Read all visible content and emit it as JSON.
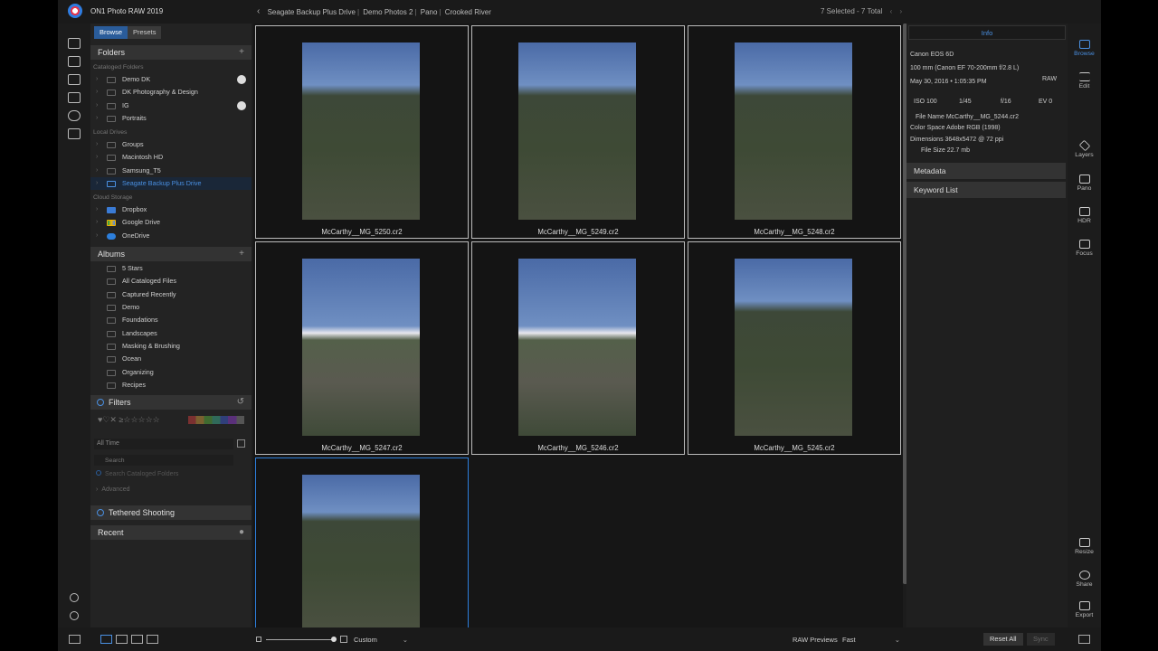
{
  "app": {
    "name": "ON1 Photo RAW 2019"
  },
  "breadcrumb": [
    "Seagate Backup Plus Drive",
    "Demo Photos 2",
    "Pano",
    "Crooked River"
  ],
  "selection": "7 Selected - 7 Total",
  "left_panel": {
    "tabs": [
      "Browse",
      "Presets"
    ],
    "folders": {
      "title": "Folders",
      "cataloged_label": "Cataloged Folders",
      "cataloged": [
        "Demo DK",
        "DK Photography & Design",
        "IG",
        "Portraits"
      ],
      "local_label": "Local Drives",
      "local": [
        "Groups",
        "Macintosh HD",
        "Samsung_T5",
        "Seagate Backup Plus Drive"
      ],
      "cloud_label": "Cloud Storage",
      "cloud": [
        "Dropbox",
        "Google Drive",
        "OneDrive"
      ]
    },
    "albums": {
      "title": "Albums",
      "items": [
        "5 Stars",
        "All Cataloged Files",
        "Captured Recently",
        "Demo",
        "Foundations",
        "Landscapes",
        "Masking & Brushing",
        "Ocean",
        "Organizing",
        "Recipes"
      ]
    },
    "filters": {
      "title": "Filters",
      "date": "All Time",
      "search_placeholder": "Search",
      "search_cataloged": "Search Cataloged Folders",
      "advanced": "Advanced"
    },
    "tethered": "Tethered Shooting",
    "recent": "Recent"
  },
  "photos": [
    {
      "name": "McCarthy__MG_5250.cr2",
      "snow": false
    },
    {
      "name": "McCarthy__MG_5249.cr2",
      "snow": false
    },
    {
      "name": "McCarthy__MG_5248.cr2",
      "snow": false
    },
    {
      "name": "McCarthy__MG_5247.cr2",
      "snow": true
    },
    {
      "name": "McCarthy__MG_5246.cr2",
      "snow": true
    },
    {
      "name": "McCarthy__MG_5245.cr2",
      "snow": false
    },
    {
      "name": "",
      "snow": false
    }
  ],
  "info": {
    "tab": "Info",
    "camera": "Canon EOS 6D",
    "lens": "100 mm (Canon EF 70-200mm f/2.8 L)",
    "format": "RAW",
    "date": "May 30, 2016 • 1:05:35 PM",
    "iso": "ISO 100",
    "shutter": "1/45",
    "aperture": "f/16",
    "ev": "EV 0",
    "filename": "File Name McCarthy__MG_5244.cr2",
    "colorspace": "Color Space Adobe RGB (1998)",
    "dimensions": "Dimensions 3648x5472 @ 72 ppi",
    "filesize": "File Size 22.7 mb",
    "metadata": "Metadata",
    "keywords": "Keyword List"
  },
  "tools": [
    "Browse",
    "Edit",
    "Layers",
    "Pano",
    "HDR",
    "Focus",
    "Resize",
    "Share",
    "Export"
  ],
  "bottom": {
    "sort": "Custom",
    "raw_label": "RAW Previews",
    "raw_value": "Fast",
    "reset": "Reset All",
    "sync": "Sync"
  },
  "colors": {
    "accent": "#2d7fdc",
    "panel": "#232323",
    "background": "#161616"
  }
}
